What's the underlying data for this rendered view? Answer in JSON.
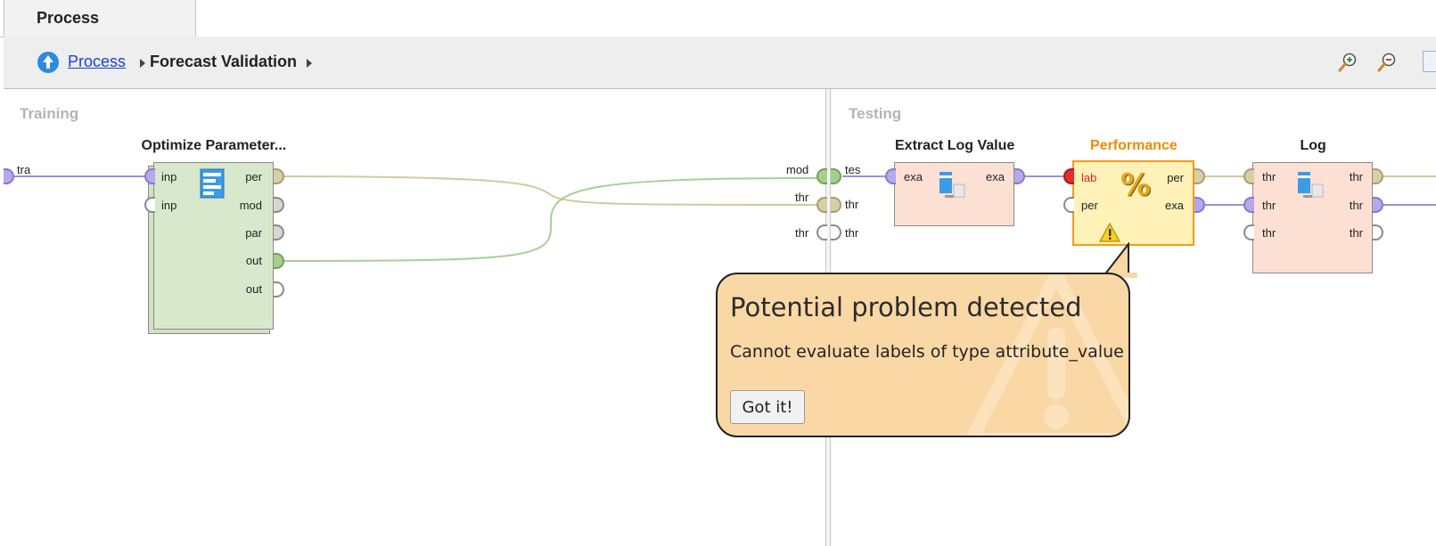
{
  "tab": {
    "label": "Process"
  },
  "breadcrumb": {
    "root": "Process",
    "current": "Forecast Validation"
  },
  "sections": {
    "training": "Training",
    "testing": "Testing"
  },
  "edges": {
    "left_input": "tra",
    "right_outputs": [
      "mod",
      "thr",
      "thr"
    ],
    "right_inputs": [
      "tes",
      "thr",
      "thr"
    ]
  },
  "operators": {
    "optimize": {
      "title": "Optimize Parameter...",
      "in_ports": [
        "inp",
        "inp"
      ],
      "out_ports": [
        "per",
        "mod",
        "par",
        "out",
        "out"
      ],
      "icon": "optimize-list-icon"
    },
    "extract": {
      "title": "Extract Log Value",
      "in_ports": [
        "exa"
      ],
      "out_ports": [
        "exa"
      ],
      "icon": "log-extract-icon"
    },
    "performance": {
      "title": "Performance",
      "in_ports": [
        "lab",
        "per"
      ],
      "out_ports": [
        "per",
        "exa"
      ],
      "icon": "percent-icon",
      "warning_icon": "warning-icon",
      "title_color": "#f08a00"
    },
    "log": {
      "title": "Log",
      "in_ports": [
        "thr",
        "thr",
        "thr"
      ],
      "out_ports": [
        "thr",
        "thr",
        "thr"
      ],
      "icon": "log-icon"
    }
  },
  "popup": {
    "title": "Potential problem detected",
    "message": "Cannot evaluate labels of type attribute_value",
    "button": "Got it!"
  },
  "toolbar": {
    "zoom_in_icon": "zoom-in-icon",
    "zoom_out_icon": "zoom-out-icon"
  },
  "colors": {
    "link": "#1a3fe0",
    "popup_bg": "#fad8a6",
    "warning_orange": "#f08a00"
  }
}
